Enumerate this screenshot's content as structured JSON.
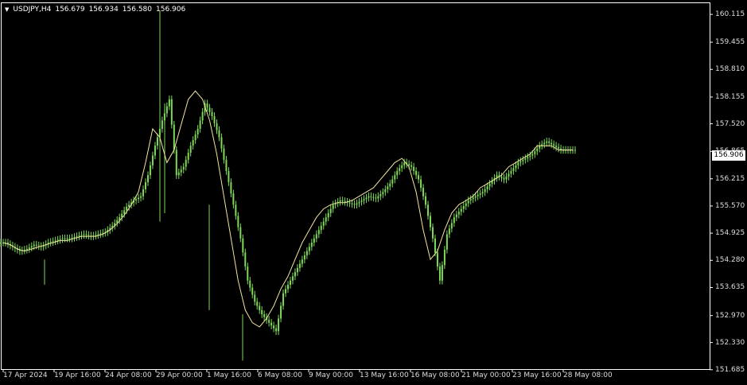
{
  "header": {
    "menu_icon": "triangle-down-icon",
    "symbol": "USDJPY,H4",
    "open": "156.679",
    "high": "156.934",
    "low": "156.580",
    "close": "156.906"
  },
  "colors": {
    "background": "#000000",
    "candle": "#7ed957",
    "moving_average": "#f2e6a0",
    "axis": "#ffffff",
    "text": "#dddddd"
  },
  "current_price_label": "156.906",
  "chart_data": {
    "type": "line",
    "instrument": "USDJPY",
    "timeframe": "H4",
    "ylim": [
      151.7,
      160.4
    ],
    "y_ticks": [
      "160.115",
      "159.455",
      "158.810",
      "158.155",
      "157.520",
      "156.865",
      "156.215",
      "155.570",
      "154.925",
      "154.280",
      "153.635",
      "152.970",
      "152.330",
      "151.685"
    ],
    "x_ticks": [
      "17 Apr 2024",
      "19 Apr 16:00",
      "24 Apr 08:00",
      "29 Apr 00:00",
      "1 May 16:00",
      "6 May 08:00",
      "9 May 00:00",
      "13 May 16:00",
      "16 May 08:00",
      "21 May 00:00",
      "23 May 16:00",
      "28 May 08:00"
    ],
    "series": [
      {
        "values": [
          154.7,
          154.6,
          154.5,
          154.55,
          154.65,
          154.6,
          154.7,
          154.75,
          154.8,
          154.8,
          154.85,
          154.9,
          154.85,
          154.9,
          154.95,
          155.1,
          155.3,
          155.55,
          155.7,
          155.8,
          156.3,
          157.0,
          157.6,
          158.1,
          156.3,
          156.5,
          157.0,
          157.4,
          158.0,
          157.7,
          157.2,
          156.4,
          155.6,
          154.8,
          153.8,
          153.3,
          153.0,
          152.8,
          152.6,
          153.5,
          153.8,
          154.1,
          154.4,
          154.7,
          155.0,
          155.3,
          155.6,
          155.7,
          155.65,
          155.6,
          155.7,
          155.8,
          155.75,
          155.9,
          156.1,
          156.4,
          156.6,
          156.5,
          156.2,
          155.6,
          154.8,
          153.8,
          154.9,
          155.3,
          155.5,
          155.7,
          155.8,
          155.9,
          156.1,
          156.3,
          156.2,
          156.4,
          156.6,
          156.7,
          156.8,
          157.0,
          157.1,
          157.0,
          156.9,
          156.9,
          156.9
        ]
      },
      {
        "values": [
          154.7,
          154.65,
          154.55,
          154.5,
          154.55,
          154.6,
          154.65,
          154.7,
          154.75,
          154.75,
          154.8,
          154.85,
          154.85,
          154.85,
          154.9,
          155.0,
          155.15,
          155.35,
          155.6,
          155.9,
          156.6,
          157.4,
          157.2,
          156.6,
          156.9,
          157.5,
          158.1,
          158.3,
          158.1,
          157.6,
          156.8,
          155.8,
          154.8,
          153.8,
          153.1,
          152.8,
          152.7,
          152.9,
          153.2,
          153.6,
          153.9,
          154.3,
          154.7,
          155.0,
          155.3,
          155.5,
          155.6,
          155.65,
          155.65,
          155.7,
          155.8,
          155.9,
          156.0,
          156.2,
          156.4,
          156.6,
          156.7,
          156.5,
          155.9,
          155.0,
          154.3,
          154.5,
          155.0,
          155.4,
          155.6,
          155.7,
          155.8,
          156.0,
          156.1,
          156.2,
          156.3,
          156.5,
          156.6,
          156.7,
          156.8,
          157.0,
          157.0,
          157.0,
          156.9,
          156.9,
          156.9
        ]
      }
    ]
  }
}
